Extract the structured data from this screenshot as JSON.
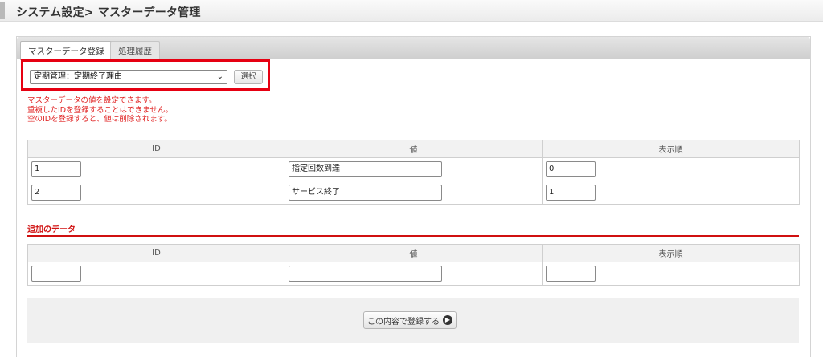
{
  "page": {
    "title": "システム設定> マスターデータ管理"
  },
  "tabs": [
    {
      "label": "マスターデータ登録",
      "active": true
    },
    {
      "label": "処理履歴",
      "active": false
    }
  ],
  "selector": {
    "selected_value": "定期管理：定期終了理由",
    "button_label": "選択"
  },
  "notes": [
    "マスターデータの値を設定できます。",
    "重複したIDを登録することはできません。",
    "空のIDを登録すると、値は削除されます。"
  ],
  "columns": {
    "id": "ID",
    "value": "値",
    "order": "表示順"
  },
  "existing_rows": [
    {
      "id": "1",
      "value": "指定回数到達",
      "order": "0"
    },
    {
      "id": "2",
      "value": "サービス終了",
      "order": "1"
    }
  ],
  "new_section": {
    "title": "追加のデータ"
  },
  "new_row": {
    "id": "",
    "value": "",
    "order": ""
  },
  "submit": {
    "label": "この内容で登録する",
    "icon": "arrow-right-circle-icon"
  },
  "colors": {
    "highlight": "#e60012",
    "notice_text": "#e02020",
    "section_red": "#d01010"
  }
}
